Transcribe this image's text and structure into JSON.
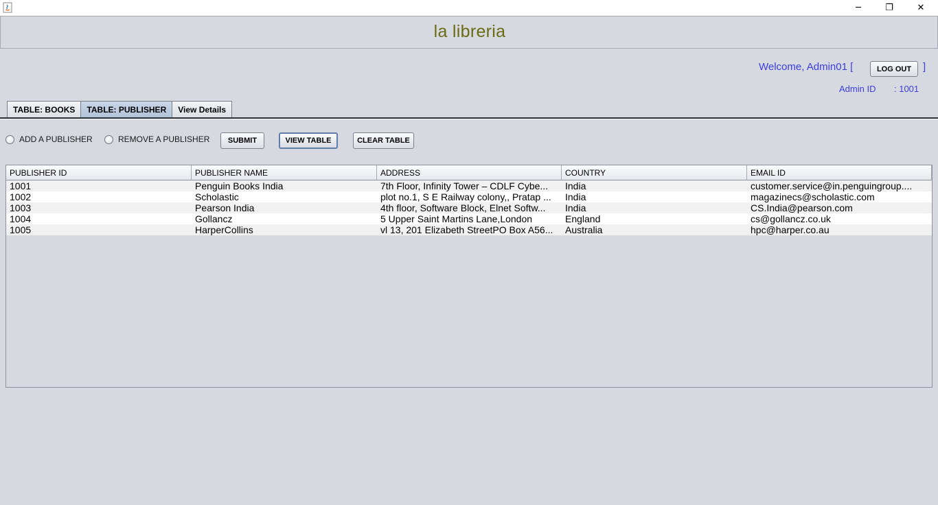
{
  "window": {
    "minimize_glyph": "─",
    "maximize_glyph": "❐",
    "close_glyph": "✕"
  },
  "header": {
    "title": "la libreria"
  },
  "user": {
    "welcome": "Welcome, Admin01 [",
    "logout_label": "LOG OUT",
    "bracket_close": "]",
    "admin_id_label": "Admin ID",
    "admin_id_value": ": 1001"
  },
  "tabs": [
    {
      "label": "TABLE: BOOKS",
      "active": false
    },
    {
      "label": "TABLE: PUBLISHER",
      "active": true
    },
    {
      "label": "View Details",
      "active": false
    }
  ],
  "actions": {
    "add_radio_label": "ADD A PUBLISHER",
    "remove_radio_label": "REMOVE A PUBLISHER",
    "submit_label": "SUBMIT",
    "view_label": "VIEW TABLE",
    "clear_label": "CLEAR TABLE"
  },
  "table": {
    "columns": [
      "PUBLISHER ID",
      "PUBLISHER NAME",
      "ADDRESS",
      "COUNTRY",
      "EMAIL ID"
    ],
    "rows": [
      [
        "1001",
        "Penguin Books India",
        "7th Floor, Infinity Tower – CDLF Cybe...",
        "India",
        " customer.service@in.penguingroup...."
      ],
      [
        "1002",
        "Scholastic",
        "plot no.1, S E Railway colony,, Pratap ...",
        "India",
        "magazinecs@scholastic.com"
      ],
      [
        "1003",
        "Pearson India",
        "4th floor, Software Block, Elnet Softw...",
        "India",
        "CS.India@pearson.com"
      ],
      [
        "1004",
        "Gollancz",
        " 5 Upper Saint Martins Lane,London",
        "England",
        "cs@gollancz.co.uk"
      ],
      [
        "1005",
        "HarperCollins",
        "vl 13, 201 Elizabeth StreetPO Box A56...",
        "Australia",
        "hpc@harper.co.au"
      ]
    ]
  },
  "colors": {
    "accent_text": "#3c3ce0",
    "title_text": "#6b6b14",
    "background": "#d6d9e0"
  }
}
